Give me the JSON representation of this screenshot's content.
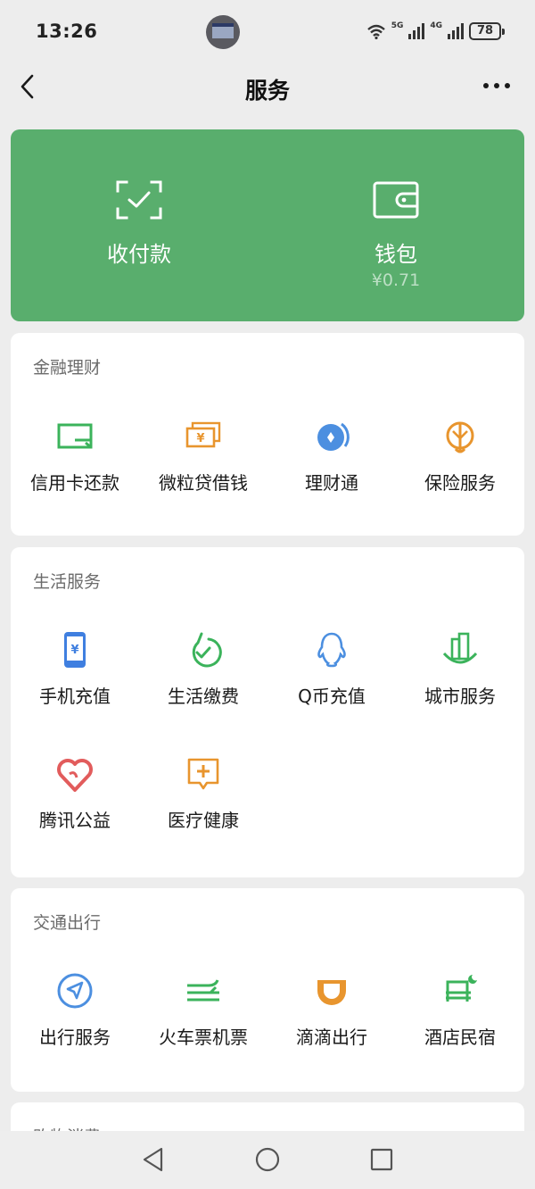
{
  "status_bar": {
    "time": "13:26",
    "network_1": "5G",
    "network_2": "4G",
    "battery": "78"
  },
  "nav": {
    "title": "服务"
  },
  "hero": {
    "pay": {
      "label": "收付款"
    },
    "wallet": {
      "label": "钱包",
      "balance": "¥0.71"
    }
  },
  "sections": {
    "finance": {
      "title": "金融理财",
      "items": [
        {
          "label": "信用卡还款",
          "icon": "credit-card-icon",
          "color": "#3bb35b"
        },
        {
          "label": "微粒贷借钱",
          "icon": "loan-cash-icon",
          "color": "#e8952e"
        },
        {
          "label": "理财通",
          "icon": "wealth-icon",
          "color": "#4c8fe0"
        },
        {
          "label": "保险服务",
          "icon": "insurance-umbrella-icon",
          "color": "#e8952e"
        }
      ]
    },
    "life": {
      "title": "生活服务",
      "items": [
        {
          "label": "手机充值",
          "icon": "phone-topup-icon",
          "color": "#3f7fe0"
        },
        {
          "label": "生活缴费",
          "icon": "utility-bill-icon",
          "color": "#3bb35b"
        },
        {
          "label": "Q币充值",
          "icon": "qq-penguin-icon",
          "color": "#4c8fe0"
        },
        {
          "label": "城市服务",
          "icon": "city-buildings-icon",
          "color": "#3bb35b"
        },
        {
          "label": "腾讯公益",
          "icon": "charity-heart-icon",
          "color": "#e25c5c"
        },
        {
          "label": "医疗健康",
          "icon": "medical-cross-icon",
          "color": "#e8952e"
        }
      ]
    },
    "travel": {
      "title": "交通出行",
      "items": [
        {
          "label": "出行服务",
          "icon": "navigation-arrow-icon",
          "color": "#4c8fe0"
        },
        {
          "label": "火车票机票",
          "icon": "train-plane-icon",
          "color": "#3bb35b"
        },
        {
          "label": "滴滴出行",
          "icon": "didi-icon",
          "color": "#e8952e"
        },
        {
          "label": "酒店民宿",
          "icon": "hotel-bed-icon",
          "color": "#3bb35b"
        }
      ]
    },
    "shopping": {
      "title": "购物消费"
    }
  },
  "colors": {
    "hero_green": "#59ae6d",
    "background": "#ededed",
    "card": "#ffffff"
  }
}
